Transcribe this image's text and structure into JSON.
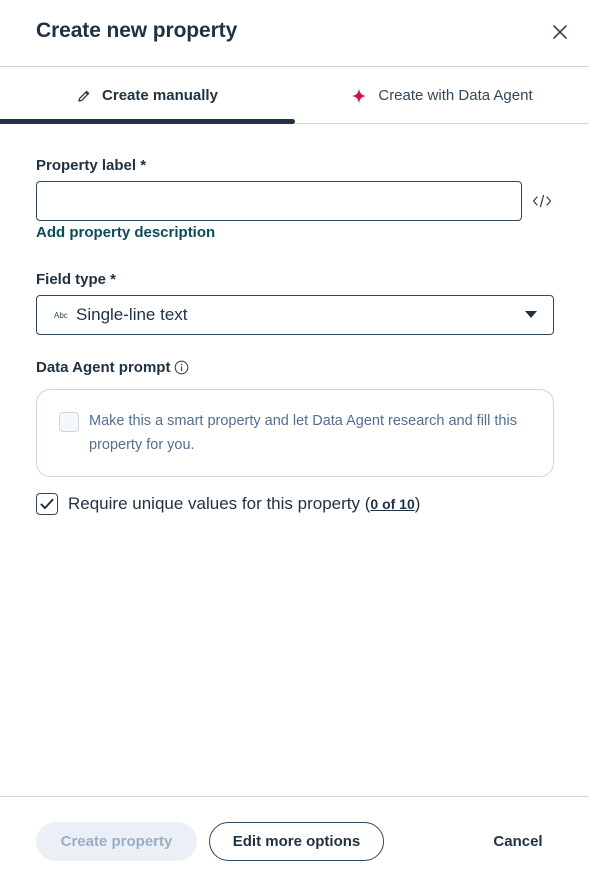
{
  "dialog": {
    "title": "Create new property"
  },
  "tabs": [
    {
      "label": "Create manually",
      "icon": "pencil-icon",
      "active": true
    },
    {
      "label": "Create with Data Agent",
      "icon": "sparkle-icon",
      "active": false
    }
  ],
  "property_label": {
    "label": "Property label *",
    "value": "",
    "placeholder": ""
  },
  "add_description_link": "Add property description",
  "field_type": {
    "label": "Field type *",
    "icon_text": "Abc",
    "selected": "Single-line text"
  },
  "data_agent": {
    "label": "Data Agent prompt",
    "checkbox_text": "Make this a smart property and let Data Agent research and fill this property for you.",
    "checked": false
  },
  "unique": {
    "text_before": "Require unique values for this property (",
    "count": "0 of 10",
    "text_after": ")",
    "checked": true
  },
  "footer": {
    "create_label": "Create property",
    "edit_label": "Edit more options",
    "cancel_label": "Cancel"
  },
  "colors": {
    "primary_text": "#213343",
    "link": "#0b4d57",
    "sparkle": "#c2185b",
    "border": "#cbd6e2",
    "disabled_bg": "#eaf0f6",
    "disabled_text": "#99afc4"
  }
}
